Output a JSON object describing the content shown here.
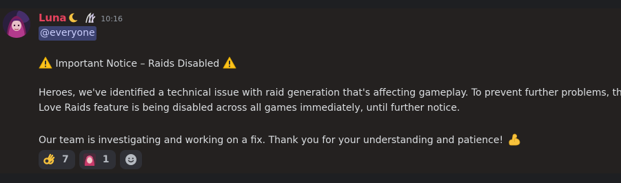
{
  "message": {
    "author": "Luna",
    "timestamp": "10:16",
    "mention": "@everyone",
    "title": "Important Notice – Raids Disabled",
    "paragraph1_line1": "Heroes, we've identified a technical issue with raid generation that's affecting gameplay. To prevent further problems, the",
    "paragraph1_line2": "Love Raids feature is being disabled across all games immediately, until further notice.",
    "paragraph2": "Our team is investigating and working on a fix. Thank you for your understanding and patience!"
  },
  "reactions": [
    {
      "icon": "ok-hand-icon",
      "count": "7"
    },
    {
      "icon": "character-emoji-icon",
      "count": "1"
    }
  ],
  "colors": {
    "author": "#e7435e",
    "mention_bg": "#3c4270",
    "mention_text": "#c9cdfb",
    "message_bg": "#242120"
  }
}
